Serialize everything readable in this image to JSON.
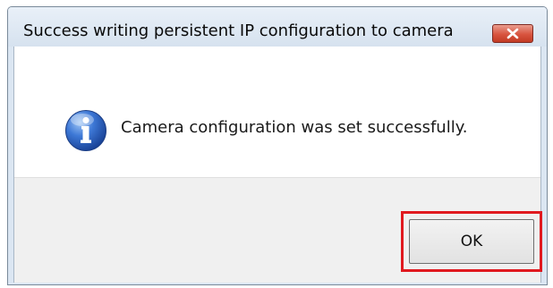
{
  "dialog": {
    "title": "Success writing persistent IP configuration to camera",
    "close_icon": "close-icon",
    "message_icon": "info-icon",
    "message": "Camera configuration was set successfully.",
    "ok_label": "OK"
  },
  "colors": {
    "title_bar": "#d6e2ef",
    "close_button": "#d8543f",
    "highlight_border": "#e0191f",
    "footer": "#f0f0f0",
    "info_icon": "#2457b8"
  }
}
